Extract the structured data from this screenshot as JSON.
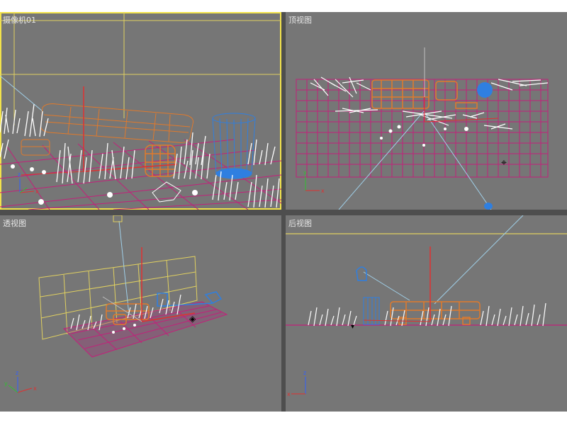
{
  "viewports": {
    "camera": {
      "label": "摄像机01"
    },
    "top": {
      "label": "顶视图"
    },
    "perspective": {
      "label": "透视图"
    },
    "back": {
      "label": "后视图"
    }
  },
  "axes": {
    "x": "x",
    "y": "y",
    "z": "z"
  },
  "colors": {
    "viewport_bg": "#767676",
    "active_border": "#f2e24b",
    "grid": "#c3207a",
    "bench": "#e07a2c",
    "bin": "#2f7fe0",
    "grass": "#ffffff",
    "camera_line": "#9fcfe8",
    "wall": "#e0d060"
  }
}
